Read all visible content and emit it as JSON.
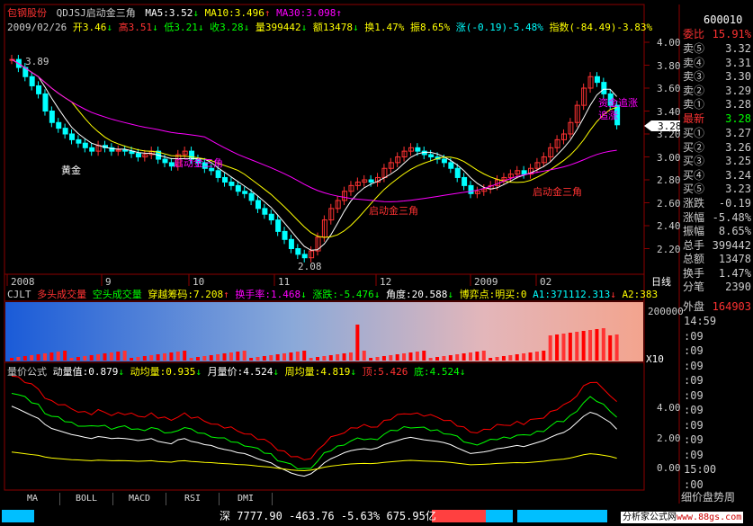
{
  "stock": {
    "name": "包钢股份",
    "formula": "QDJSJ启动金三角",
    "ma5": "MA5:3.52",
    "ma10": "MA10:3.496",
    "ma30": "MA30:3.098",
    "date": "2009/02/26",
    "open": "开3.46",
    "high": "高3.51",
    "low": "低3.21",
    "close": "收3.28",
    "volume": "量399442",
    "amount": "额13478",
    "turnover": "换1.47%",
    "amplitude": "振8.65%",
    "change": "涨(-0.19)-5.48%",
    "index": "指数(-84.49)-3.83%"
  },
  "price_axis": [
    "4.00",
    "3.80",
    "3.60",
    "3.40",
    "3.20",
    "3.00",
    "2.80",
    "2.60",
    "2.40",
    "2.20"
  ],
  "price_marker": "3.28",
  "chart_annotations": {
    "high_label": "3.89",
    "low_label": "2.08",
    "gold": "黄金",
    "a1": "启动金三角",
    "a2": "启动金三角",
    "a3": "启动金三角",
    "a4": "追涨",
    "a5": "资金追涨"
  },
  "time_axis": [
    "2008",
    "9",
    "10",
    "11",
    "12",
    "2009",
    "02"
  ],
  "daily_label": "日线",
  "cjlt": {
    "name": "CJLT",
    "many": "多头成交量",
    "empty": "空头成交量",
    "cross": "穿越筹码:7.208",
    "hand": "换手率:1.468",
    "rise": "涨跌:-5.476",
    "angle": "角度:20.588",
    "game": "博弈点:明买:0",
    "a1": "A1:371112.313",
    "a2": "A2:383",
    "axis_top": "200000",
    "axis_unit": "X10"
  },
  "lbgs": {
    "name": "量价公式",
    "dl": "动量值:0.879",
    "dj": "动均量:0.935",
    "yl": "月量价:4.524",
    "zl": "周均量:4.819",
    "top": "顶:5.426",
    "bottom": "底:4.524",
    "axis1": "4.00",
    "axis2": "2.00",
    "axis3": "0.00"
  },
  "tabs": [
    "MA",
    "BOLL",
    "MACD",
    "RSI",
    "DMI"
  ],
  "right_panel": {
    "code": "600010",
    "ratio_label": "委比",
    "ratio_value": "15.91%",
    "sells": [
      [
        "卖⑤",
        "3.32"
      ],
      [
        "卖④",
        "3.31"
      ],
      [
        "卖③",
        "3.30"
      ],
      [
        "卖②",
        "3.29"
      ],
      [
        "卖①",
        "3.28"
      ]
    ],
    "latest_label": "最新",
    "latest_value": "3.28",
    "buys": [
      [
        "买①",
        "3.27"
      ],
      [
        "买②",
        "3.26"
      ],
      [
        "买③",
        "3.25"
      ],
      [
        "买④",
        "3.24"
      ],
      [
        "买⑤",
        "3.23"
      ]
    ],
    "stats": [
      [
        "涨跌",
        "-0.19"
      ],
      [
        "涨幅",
        "-5.48%"
      ],
      [
        "振幅",
        "8.65%"
      ],
      [
        "总手",
        "399442"
      ],
      [
        "总额",
        "13478"
      ],
      [
        "换手",
        "1.47%"
      ],
      [
        "分笔",
        "2390"
      ]
    ],
    "outer_label": "外盘",
    "outer_value": "164903",
    "times": [
      "14:59",
      ":09",
      ":09",
      ":09",
      ":09",
      ":09",
      ":09",
      ":09",
      ":09",
      ":09",
      "15:00",
      ":00"
    ],
    "bottom_tabs": "细价盘势周"
  },
  "status": {
    "index_name": "深",
    "index_value": "7777.90",
    "index_change": "-463.76",
    "index_pct": "-5.63%",
    "index_amount": "675.95亿",
    "site": "分析家公式网",
    "site_url": "www.88gs.com"
  },
  "colors": {
    "up": "#ff3232",
    "down": "#00ffff",
    "ma5": "#ffffff",
    "ma10": "#ffff00",
    "ma30": "#ff00ff",
    "grid": "#8b0000"
  }
}
